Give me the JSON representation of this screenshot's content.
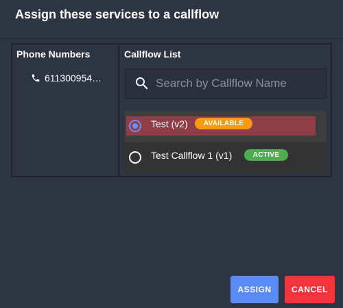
{
  "dialog": {
    "title": "Assign these services to a callflow"
  },
  "phone_numbers": {
    "header": "Phone Numbers",
    "items": [
      {
        "number": "611300954…",
        "icon": "phone-icon"
      }
    ]
  },
  "callflow_list": {
    "header": "Callflow List",
    "search": {
      "placeholder": "Search by Callflow Name",
      "value": "",
      "icon": "search-icon"
    },
    "items": [
      {
        "name": "Test (v2)",
        "badge": "AVAILABLE",
        "badge_color": "#f59a12",
        "selected": true
      },
      {
        "name": "Test Callflow 1 (v1)",
        "badge": "ACTIVE",
        "badge_color": "#4cae50",
        "selected": false
      }
    ]
  },
  "actions": {
    "assign_label": "ASSIGN",
    "cancel_label": "CANCEL"
  },
  "colors": {
    "background": "#2d3442",
    "assign": "#5b8cf5",
    "cancel": "#f4333b",
    "selected_highlight": "#8f3e47",
    "radio_selected": "#6d8ff5"
  }
}
